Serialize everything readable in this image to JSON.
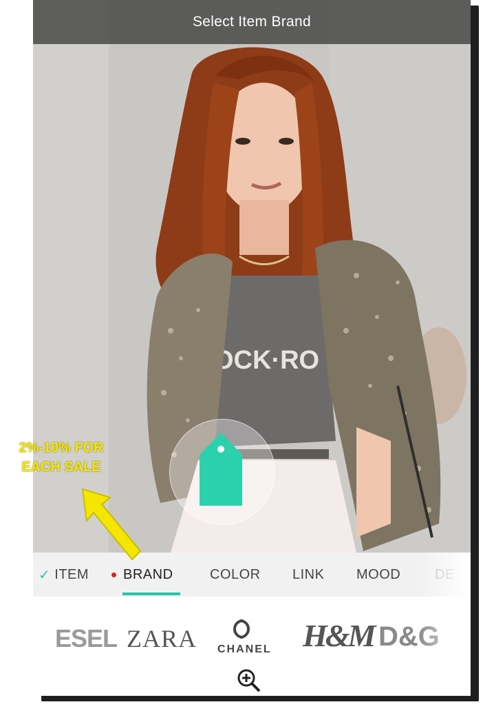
{
  "header": {
    "title": "Select Item Brand"
  },
  "tabs": [
    {
      "label": "ITEM",
      "state": "completed"
    },
    {
      "label": "BRAND",
      "state": "active"
    },
    {
      "label": "COLOR",
      "state": "default"
    },
    {
      "label": "LINK",
      "state": "default"
    },
    {
      "label": "MOOD",
      "state": "default"
    },
    {
      "label": "DE",
      "state": "partial"
    }
  ],
  "brands": {
    "diesel": "ESEL",
    "zara": "ZARA",
    "chanel": "CHANEL",
    "hm": "H&M",
    "dg": "D&G"
  },
  "promo": {
    "line1": "2%-10% FOR",
    "line2": "EACH SALE"
  },
  "icons": {
    "check": "check-icon",
    "tag": "price-tag-icon",
    "zoom": "zoom-in-icon",
    "arrow": "arrow-icon"
  },
  "colors": {
    "accent": "#25c7aa",
    "active_dot": "#e02020",
    "promo_text": "#f5e600"
  }
}
